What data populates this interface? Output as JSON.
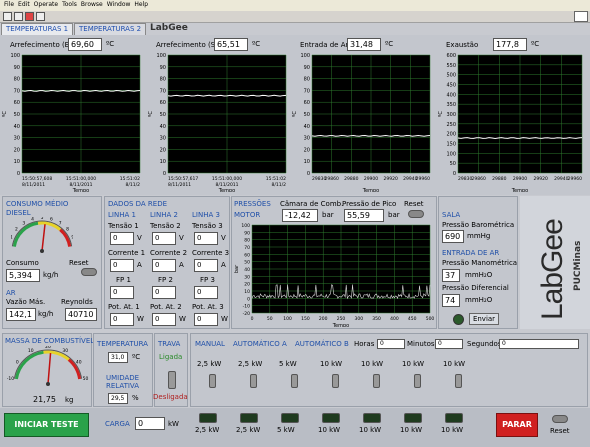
{
  "menu": [
    "File",
    "Edit",
    "Operate",
    "Tools",
    "Browse",
    "Window",
    "Help"
  ],
  "tabs": [
    "TEMPERATURAS 1",
    "TEMPERATURAS 2"
  ],
  "logo_small": "LabGee",
  "graphs": [
    {
      "title": "Arrefecimento (Entrada)",
      "value": "69,60",
      "unit": "ºC",
      "ylabel": "ºC",
      "xlabel": "Tempo",
      "yticks": [
        "100",
        "90",
        "80",
        "70",
        "60",
        "50",
        "40",
        "30",
        "20",
        "10",
        "0"
      ],
      "xticks": [
        "15:50:57,608\n8/11/2011",
        "15:51:00,000\n8/11/2011",
        "15:51:02\n8/11/2"
      ]
    },
    {
      "title": "Arrefecimento (Saída)",
      "value": "65,51",
      "unit": "ºC",
      "ylabel": "ºC",
      "xlabel": "Tempo",
      "yticks": [
        "100",
        "90",
        "80",
        "70",
        "60",
        "50",
        "40",
        "30",
        "20",
        "10",
        "0"
      ],
      "xticks": [
        "15:50:57,617\n8/11/2011",
        "15:51:00,000\n8/11/2011",
        "15:51:02\n8/11/2"
      ]
    },
    {
      "title": "Entrada de Ar",
      "value": "31,48",
      "unit": "ºC",
      "ylabel": "ºC",
      "xlabel": "Tempo",
      "yticks": [
        "100",
        "90",
        "80",
        "70",
        "60",
        "50",
        "40",
        "30",
        "20",
        "10",
        "0"
      ],
      "xticks": [
        "29830",
        "29860",
        "29880",
        "29900",
        "29920",
        "29940",
        "29960"
      ]
    },
    {
      "title": "Exaustão",
      "value": "177,8",
      "unit": "ºC",
      "ylabel": "ºC",
      "xlabel": "Tempo",
      "yticks": [
        "600",
        "550",
        "500",
        "450",
        "400",
        "350",
        "300",
        "250",
        "200",
        "150",
        "100",
        "50",
        "0"
      ],
      "xticks": [
        "29830",
        "29860",
        "29880",
        "29900",
        "29920",
        "29940",
        "29960"
      ]
    }
  ],
  "consumo": {
    "title": "CONSUMO MÉDIO",
    "subtitle": "DIESEL",
    "consumo_label": "Consumo",
    "reset_label": "Reset",
    "value": "5,394",
    "unit": "kg/h",
    "gauge_ticks": [
      "0",
      "1",
      "2",
      "3",
      "4",
      "5",
      "6",
      "7",
      "8",
      "9",
      "10"
    ],
    "ar_label": "AR",
    "vazao_label": "Vazão Más.",
    "reynolds_label": "Reynolds",
    "vazao_value": "142,1",
    "vazao_unit": "kg/h",
    "reynolds_value": "40710"
  },
  "rede": {
    "title": "DADOS DA REDE",
    "lines": [
      {
        "name": "LINHA 1",
        "tensao_label": "Tensão 1",
        "tensao": "0",
        "tensao_unit": "V",
        "corrente_label": "Corrente 1",
        "corrente": "0",
        "corrente_unit": "A",
        "fp_label": "FP 1",
        "fp": "0",
        "pot_label": "Pot. At. 1",
        "pot": "0",
        "pot_unit": "W"
      },
      {
        "name": "LINHA 2",
        "tensao_label": "Tensão 2",
        "tensao": "0",
        "tensao_unit": "V",
        "corrente_label": "Corrente 2",
        "corrente": "0",
        "corrente_unit": "A",
        "fp_label": "FP 2",
        "fp": "0",
        "pot_label": "Pot. At. 2",
        "pot": "0",
        "pot_unit": "W"
      },
      {
        "name": "LINHA 3",
        "tensao_label": "Tensão 3",
        "tensao": "0",
        "tensao_unit": "V",
        "corrente_label": "Corrente 3",
        "corrente": "0",
        "corrente_unit": "A",
        "fp_label": "FP 3",
        "fp": "0",
        "pot_label": "Pot. At. 3",
        "pot": "0",
        "pot_unit": "W"
      }
    ]
  },
  "pressoes": {
    "title": "PRESSÕES",
    "motor": "MOTOR",
    "camara_label": "Câmara de Comb.",
    "pico_label": "Pressão de Pico",
    "reset_label": "Reset",
    "camara_value": "-12,42",
    "camara_unit": "bar",
    "pico_value": "55,59",
    "pico_unit": "bar",
    "ylabel": "bar",
    "xlabel": "Tempo",
    "yticks": [
      "100",
      "90",
      "80",
      "70",
      "60",
      "50",
      "40",
      "30",
      "20",
      "10",
      "0",
      "-10",
      "-20"
    ],
    "xticks": [
      "0",
      "50",
      "100",
      "150",
      "200",
      "250",
      "300",
      "350",
      "400",
      "450",
      "500"
    ]
  },
  "sala": {
    "title": "SALA",
    "baro_label": "Pressão Barométrica",
    "baro_value": "690",
    "baro_unit": "mmHg",
    "entrada_ar": "ENTRADA DE AR",
    "mano_label": "Pressão Manométrica",
    "mano_value": "37",
    "mano_unit": "mmH₂O",
    "dif_label": "Pressão Diferencial",
    "dif_value": "74",
    "dif_unit": "mmH₂O",
    "enviar": "Enviar"
  },
  "logo_big": "LabGee",
  "logo_sub": "PUCMinas",
  "massa": {
    "title": "MASSA DE COMBUSTÍVEL",
    "value": "21,75",
    "unit": "kg",
    "gauge_ticks": [
      "-10",
      "0",
      "10",
      "20",
      "30",
      "40",
      "50"
    ]
  },
  "temperatura": {
    "title": "TEMPERATURA",
    "value": "31,0",
    "unit": "ºC",
    "umidade_label": "UMIDADE RELATIVA",
    "umidade_value": "29,5",
    "umidade_unit": "%"
  },
  "trava": {
    "title": "TRAVA",
    "ligada": "Ligada",
    "desligada": "Desligada"
  },
  "cargas": {
    "tabs": [
      "MANUAL",
      "AUTOMÁTICO A",
      "AUTOMÁTICO B"
    ],
    "horas_label": "Horas",
    "horas": "0",
    "minutos_label": "Minutos",
    "minutos": "0",
    "segundos_label": "Segundos",
    "segundos": "0",
    "labels": [
      "2,5 kW",
      "2,5 kW",
      "5 kW",
      "10 kW",
      "10 kW",
      "10 kW",
      "10 kW"
    ]
  },
  "bottom": {
    "iniciar": "INICIAR TESTE",
    "carga_label": "CARGA",
    "carga_value": "0",
    "carga_unit": "kW",
    "parar": "PARAR",
    "reset": "Reset"
  },
  "colors": {
    "start_green": "#2aa24a",
    "stop_red": "#d02020",
    "label_blue": "#1f4fa8",
    "plot_line": "#ffffff",
    "grid": "#2e7a2e"
  }
}
